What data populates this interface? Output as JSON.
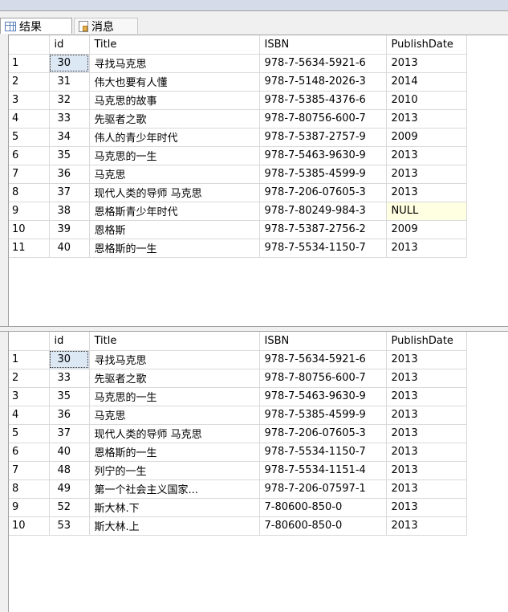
{
  "tabs": [
    {
      "label": "结果",
      "icon": "grid-icon",
      "active": true
    },
    {
      "label": "消息",
      "icon": "message-icon",
      "active": false
    }
  ],
  "columns": [
    "id",
    "Title",
    "ISBN",
    "PublishDate"
  ],
  "result1": [
    {
      "n": "1",
      "id": "30",
      "title": "寻找马克思",
      "isbn": "978-7-5634-5921-6",
      "date": "2013"
    },
    {
      "n": "2",
      "id": "31",
      "title": "伟大也要有人懂",
      "isbn": "978-7-5148-2026-3",
      "date": "2014"
    },
    {
      "n": "3",
      "id": "32",
      "title": "马克思的故事",
      "isbn": "978-7-5385-4376-6",
      "date": "2010"
    },
    {
      "n": "4",
      "id": "33",
      "title": "先驱者之歌",
      "isbn": "978-7-80756-600-7",
      "date": "2013"
    },
    {
      "n": "5",
      "id": "34",
      "title": "伟人的青少年时代",
      "isbn": "978-7-5387-2757-9",
      "date": "2009"
    },
    {
      "n": "6",
      "id": "35",
      "title": "马克思的一生",
      "isbn": "978-7-5463-9630-9",
      "date": "2013"
    },
    {
      "n": "7",
      "id": "36",
      "title": "马克思",
      "isbn": "978-7-5385-4599-9",
      "date": "2013"
    },
    {
      "n": "8",
      "id": "37",
      "title": "现代人类的导师 马克思",
      "isbn": "978-7-206-07605-3",
      "date": "2013"
    },
    {
      "n": "9",
      "id": "38",
      "title": "恩格斯青少年时代",
      "isbn": "978-7-80249-984-3",
      "date": "NULL"
    },
    {
      "n": "10",
      "id": "39",
      "title": "恩格斯",
      "isbn": "978-7-5387-2756-2",
      "date": "2009"
    },
    {
      "n": "11",
      "id": "40",
      "title": "恩格斯的一生",
      "isbn": "978-7-5534-1150-7",
      "date": "2013"
    }
  ],
  "result2": [
    {
      "n": "1",
      "id": "30",
      "title": "寻找马克思",
      "isbn": "978-7-5634-5921-6",
      "date": "2013"
    },
    {
      "n": "2",
      "id": "33",
      "title": "先驱者之歌",
      "isbn": "978-7-80756-600-7",
      "date": "2013"
    },
    {
      "n": "3",
      "id": "35",
      "title": "马克思的一生",
      "isbn": "978-7-5463-9630-9",
      "date": "2013"
    },
    {
      "n": "4",
      "id": "36",
      "title": "马克思",
      "isbn": "978-7-5385-4599-9",
      "date": "2013"
    },
    {
      "n": "5",
      "id": "37",
      "title": "现代人类的导师 马克思",
      "isbn": "978-7-206-07605-3",
      "date": "2013"
    },
    {
      "n": "6",
      "id": "40",
      "title": "恩格斯的一生",
      "isbn": "978-7-5534-1150-7",
      "date": "2013"
    },
    {
      "n": "7",
      "id": "48",
      "title": "列宁的一生",
      "isbn": "978-7-5534-1151-4",
      "date": "2013"
    },
    {
      "n": "8",
      "id": "49",
      "title": "第一个社会主义国家...",
      "isbn": "978-7-206-07597-1",
      "date": "2013"
    },
    {
      "n": "9",
      "id": "52",
      "title": "斯大林.下",
      "isbn": "7-80600-850-0",
      "date": "2013"
    },
    {
      "n": "10",
      "id": "53",
      "title": "斯大林.上",
      "isbn": "7-80600-850-0",
      "date": "2013"
    }
  ]
}
